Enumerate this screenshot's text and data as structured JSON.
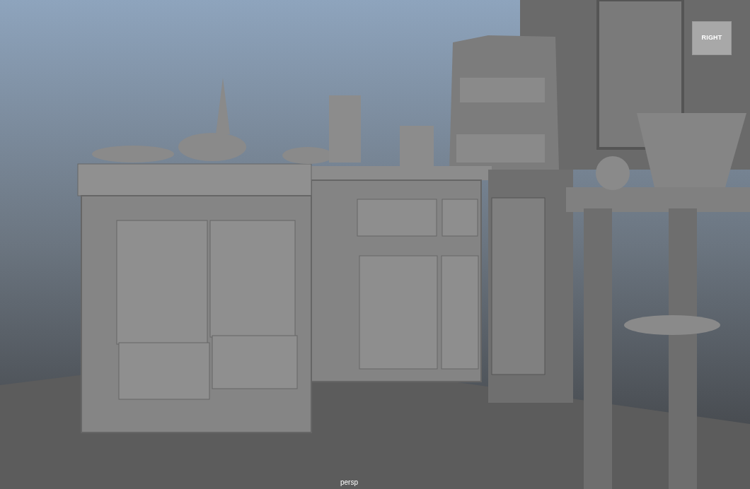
{
  "view_cube": {
    "face_label": "RIGHT"
  },
  "viewport": {
    "camera_label": "persp"
  }
}
